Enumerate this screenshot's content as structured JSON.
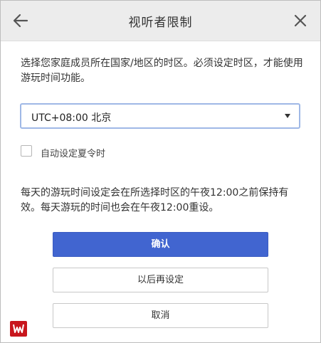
{
  "header": {
    "title": "视听者限制",
    "back_icon": "arrow-left-icon",
    "close_icon": "close-icon"
  },
  "intro_text": "选择您家庭成员所在国家/地区的时区。必须设定时区，才能使用游玩时间功能。",
  "timezone_select": {
    "value": "UTC+08:00 北京"
  },
  "dst_checkbox": {
    "label": "自动设定夏令时",
    "checked": false
  },
  "note_text": "每天的游玩时间设定会在所选择时区的午夜12:00之前保持有效。每天游玩的时间也会在午夜12:00重设。",
  "buttons": {
    "confirm": "确认",
    "later": "以后再设定",
    "cancel": "取消"
  },
  "colors": {
    "primary": "#4165d0",
    "header_bg": "#ececec",
    "select_border": "#9fb8e6"
  }
}
